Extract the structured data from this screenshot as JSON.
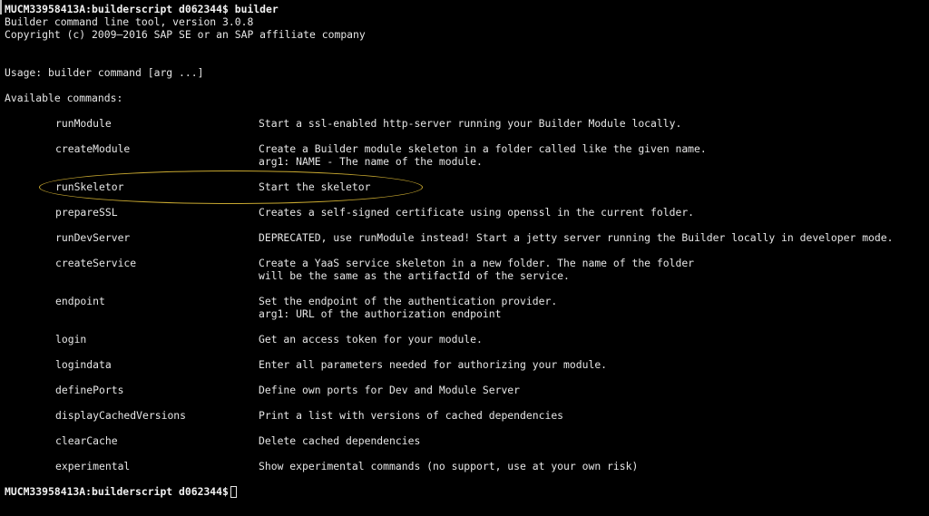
{
  "prompt": {
    "host": "MUCM33958413A:builderscript d062344$",
    "command": "builder"
  },
  "header": {
    "version_line": "Builder command line tool, version 3.0.8",
    "copyright_line": "Copyright (c) 2009–2016 SAP SE or an SAP affiliate company",
    "usage_line": "Usage: builder command [arg ...]",
    "available_line": "Available commands:"
  },
  "commands": [
    {
      "name": "runModule",
      "desc": [
        "Start a ssl-enabled http-server running your Builder Module locally."
      ]
    },
    {
      "name": "createModule",
      "desc": [
        "Create a Builder module skeleton in a folder called like the given name.",
        "arg1: NAME - The name of the module."
      ]
    },
    {
      "name": "runSkeletor",
      "desc": [
        "Start the skeletor"
      ]
    },
    {
      "name": "prepareSSL",
      "desc": [
        "Creates a self-signed certificate using openssl in the current folder."
      ]
    },
    {
      "name": "runDevServer",
      "desc": [
        "DEPRECATED, use runModule instead! Start a jetty server running the Builder locally in developer mode."
      ]
    },
    {
      "name": "createService",
      "desc": [
        "Create a YaaS service skeleton in a new folder. The name of the folder",
        "will be the same as the artifactId of the service."
      ]
    },
    {
      "name": "endpoint",
      "desc": [
        "Set the endpoint of the authentication provider.",
        "arg1: URL of the authorization endpoint"
      ]
    },
    {
      "name": "login",
      "desc": [
        "Get an access token for your module."
      ]
    },
    {
      "name": "logindata",
      "desc": [
        "Enter all parameters needed for authorizing your module."
      ]
    },
    {
      "name": "definePorts",
      "desc": [
        "Define own ports for Dev and Module Server"
      ]
    },
    {
      "name": "displayCachedVersions",
      "desc": [
        "Print a list with versions of cached dependencies"
      ]
    },
    {
      "name": "clearCache",
      "desc": [
        "Delete cached dependencies"
      ]
    },
    {
      "name": "experimental",
      "desc": [
        "Show experimental commands (no support, use at your own risk)"
      ]
    }
  ],
  "final_prompt": "MUCM33958413A:builderscript d062344$",
  "colors": {
    "background": "#000000",
    "text": "#e6e6e6",
    "highlight": "#c8a830"
  }
}
